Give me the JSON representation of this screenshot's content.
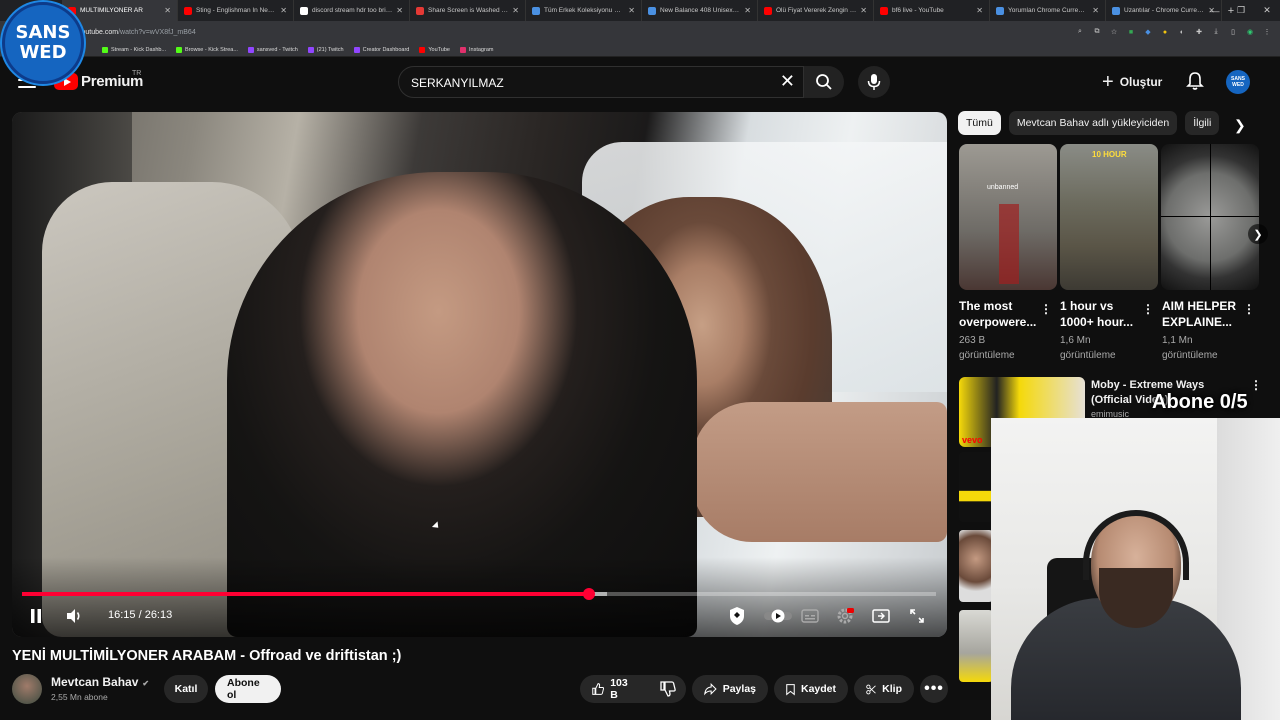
{
  "browser": {
    "tabs": [
      {
        "label": "MULTİMİLYONER AR",
        "color": "#ff0000",
        "active": true
      },
      {
        "label": "Sting - Englishman In New Yo",
        "color": "#ff0000"
      },
      {
        "label": "discord stream hdr too bright",
        "color": "#ffffff"
      },
      {
        "label": "Share Screen is Washed Out a",
        "color": "#e53935"
      },
      {
        "label": "Tüm Erkek Koleksiyonu Mode",
        "color": "#4a90e2"
      },
      {
        "label": "New Balance 408 Unisex Gri S",
        "color": "#4a90e2"
      },
      {
        "label": "Ölü Fiyat Vererek Zengin Olm",
        "color": "#ff0000"
      },
      {
        "label": "bf6 live - YouTube",
        "color": "#ff0000"
      },
      {
        "label": "Yorumlan Chrome Currency C",
        "color": "#4a90e2"
      },
      {
        "label": "Uzantılar - Chrome Currency",
        "color": "#4a90e2"
      }
    ],
    "url_host": "youtube.com",
    "url_path": "/watch?v=wVX8fJ_mB64",
    "bookmarks": [
      {
        "label": "Stream - Kick Dashb...",
        "color": "#53fc18"
      },
      {
        "label": "Browse - Kick Strea...",
        "color": "#53fc18"
      },
      {
        "label": "sansved - Twitch",
        "color": "#9146ff"
      },
      {
        "label": "(21) Twitch",
        "color": "#9146ff"
      },
      {
        "label": "Creator Dashboard",
        "color": "#9146ff"
      },
      {
        "label": "YouTube",
        "color": "#ff0000"
      },
      {
        "label": "Instagram",
        "color": "#e1306c"
      }
    ]
  },
  "overlay_logo": {
    "line1": "SANS",
    "line2": "WED"
  },
  "header": {
    "logo_text": "Premium",
    "country": "TR",
    "search_value": "SERKANYILMAZ",
    "create_label": "Oluştur",
    "avatar_text": "SANS WED"
  },
  "player": {
    "time": "16:15 / 26:13",
    "progress": 0.62,
    "buffered": 0.64
  },
  "video": {
    "title": "YENİ MULTİMİLYONER ARABAM - Offroad ve driftistan ;)",
    "channel": "Mevtcan Bahav",
    "subs": "2,55 Mn abone",
    "join": "Katıl",
    "subscribe": "Abone ol",
    "likes": "103 B",
    "share": "Paylaş",
    "save": "Kaydet",
    "clip": "Klip"
  },
  "chips": [
    "Tümü",
    "Mevtcan Bahav adlı yükleyiciden",
    "İlgili"
  ],
  "shorts": [
    {
      "title": "The most overpowere...",
      "views": "263 B",
      "views2": "görüntüleme",
      "tag": "unbanned"
    },
    {
      "title": "1 hour vs 1000+ hour...",
      "views": "1,6 Mn",
      "views2": "görüntüleme",
      "tag": "10 HOUR"
    },
    {
      "title": "AIM HELPER EXPLAINE...",
      "views": "1,1 Mn",
      "views2": "görüntüleme",
      "tag": ""
    }
  ],
  "rec": {
    "title": "Moby - Extreme Ways (Official Video)",
    "channel": "emimusic",
    "vevo": "vevo"
  },
  "overlay": {
    "subgoal": "Abone 0/5"
  }
}
